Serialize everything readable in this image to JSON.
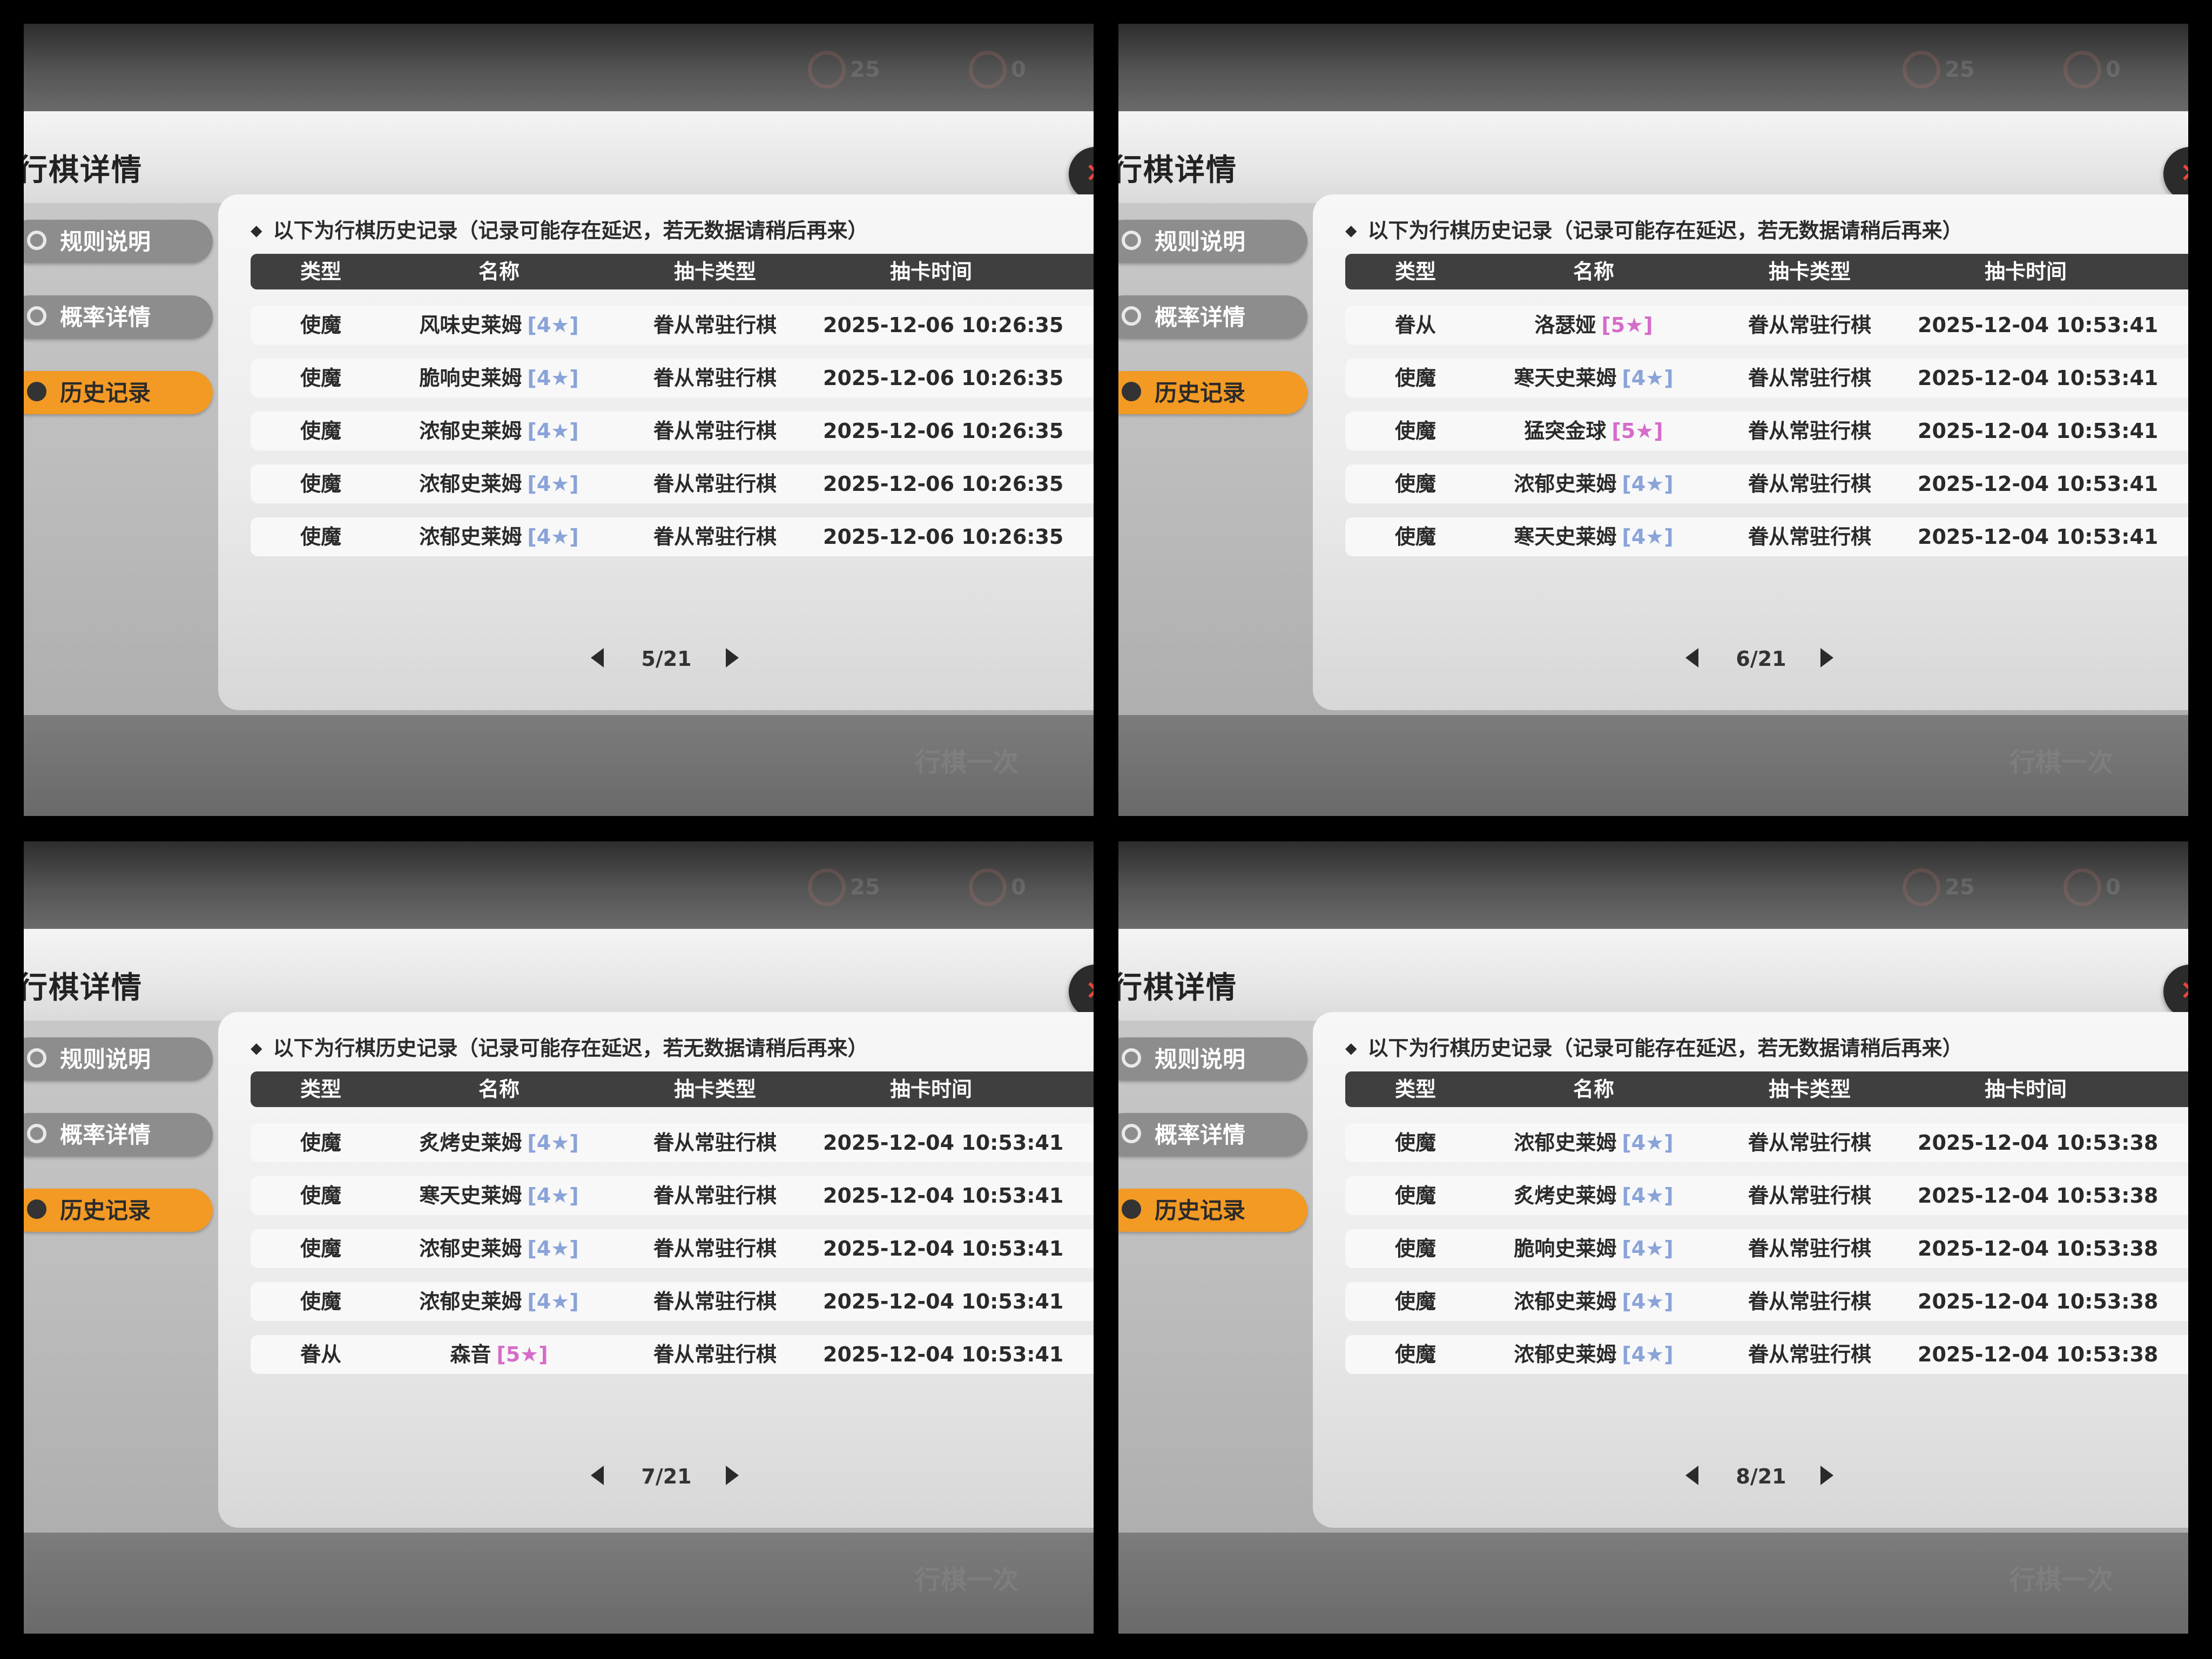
{
  "panels": [
    {
      "title": "行棋详情",
      "close_icon": "×",
      "hud": {
        "a": "25",
        "b": "0"
      },
      "tabs": [
        "规则说明",
        "概率详情",
        "历史记录"
      ],
      "notice": "以下为行棋历史记录（记录可能存在延迟，若无数据请稍后再来）",
      "headers": [
        "类型",
        "名称",
        "抽卡类型",
        "抽卡时间"
      ],
      "rows": [
        {
          "type": "使魔",
          "name": "风味史莱姆",
          "rarity": "[4★]",
          "rarity_level": 4,
          "pool": "眷从常驻行棋",
          "time": "2025-12-06 10:26:35"
        },
        {
          "type": "使魔",
          "name": "脆响史莱姆",
          "rarity": "[4★]",
          "rarity_level": 4,
          "pool": "眷从常驻行棋",
          "time": "2025-12-06 10:26:35"
        },
        {
          "type": "使魔",
          "name": "浓郁史莱姆",
          "rarity": "[4★]",
          "rarity_level": 4,
          "pool": "眷从常驻行棋",
          "time": "2025-12-06 10:26:35"
        },
        {
          "type": "使魔",
          "name": "浓郁史莱姆",
          "rarity": "[4★]",
          "rarity_level": 4,
          "pool": "眷从常驻行棋",
          "time": "2025-12-06 10:26:35"
        },
        {
          "type": "使魔",
          "name": "浓郁史莱姆",
          "rarity": "[4★]",
          "rarity_level": 4,
          "pool": "眷从常驻行棋",
          "time": "2025-12-06 10:26:35"
        }
      ],
      "page": "5/21",
      "bottom_hint": "行棋一次"
    },
    {
      "title": "行棋详情",
      "close_icon": "×",
      "hud": {
        "a": "25",
        "b": "0"
      },
      "tabs": [
        "规则说明",
        "概率详情",
        "历史记录"
      ],
      "notice": "以下为行棋历史记录（记录可能存在延迟，若无数据请稍后再来）",
      "headers": [
        "类型",
        "名称",
        "抽卡类型",
        "抽卡时间"
      ],
      "rows": [
        {
          "type": "眷从",
          "name": "洛瑟娅",
          "rarity": "[5★]",
          "rarity_level": 5,
          "pool": "眷从常驻行棋",
          "time": "2025-12-04 10:53:41"
        },
        {
          "type": "使魔",
          "name": "寒天史莱姆",
          "rarity": "[4★]",
          "rarity_level": 4,
          "pool": "眷从常驻行棋",
          "time": "2025-12-04 10:53:41"
        },
        {
          "type": "使魔",
          "name": "猛突金球",
          "rarity": "[5★]",
          "rarity_level": 5,
          "pool": "眷从常驻行棋",
          "time": "2025-12-04 10:53:41"
        },
        {
          "type": "使魔",
          "name": "浓郁史莱姆",
          "rarity": "[4★]",
          "rarity_level": 4,
          "pool": "眷从常驻行棋",
          "time": "2025-12-04 10:53:41"
        },
        {
          "type": "使魔",
          "name": "寒天史莱姆",
          "rarity": "[4★]",
          "rarity_level": 4,
          "pool": "眷从常驻行棋",
          "time": "2025-12-04 10:53:41"
        }
      ],
      "page": "6/21",
      "bottom_hint": "行棋一次"
    },
    {
      "title": "行棋详情",
      "close_icon": "×",
      "hud": {
        "a": "25",
        "b": "0"
      },
      "tabs": [
        "规则说明",
        "概率详情",
        "历史记录"
      ],
      "notice": "以下为行棋历史记录（记录可能存在延迟，若无数据请稍后再来）",
      "headers": [
        "类型",
        "名称",
        "抽卡类型",
        "抽卡时间"
      ],
      "rows": [
        {
          "type": "使魔",
          "name": "炙烤史莱姆",
          "rarity": "[4★]",
          "rarity_level": 4,
          "pool": "眷从常驻行棋",
          "time": "2025-12-04 10:53:41"
        },
        {
          "type": "使魔",
          "name": "寒天史莱姆",
          "rarity": "[4★]",
          "rarity_level": 4,
          "pool": "眷从常驻行棋",
          "time": "2025-12-04 10:53:41"
        },
        {
          "type": "使魔",
          "name": "浓郁史莱姆",
          "rarity": "[4★]",
          "rarity_level": 4,
          "pool": "眷从常驻行棋",
          "time": "2025-12-04 10:53:41"
        },
        {
          "type": "使魔",
          "name": "浓郁史莱姆",
          "rarity": "[4★]",
          "rarity_level": 4,
          "pool": "眷从常驻行棋",
          "time": "2025-12-04 10:53:41"
        },
        {
          "type": "眷从",
          "name": "森音",
          "rarity": "[5★]",
          "rarity_level": 5,
          "pool": "眷从常驻行棋",
          "time": "2025-12-04 10:53:41"
        }
      ],
      "page": "7/21",
      "bottom_hint": "行棋一次"
    },
    {
      "title": "行棋详情",
      "close_icon": "×",
      "hud": {
        "a": "25",
        "b": "0"
      },
      "tabs": [
        "规则说明",
        "概率详情",
        "历史记录"
      ],
      "notice": "以下为行棋历史记录（记录可能存在延迟，若无数据请稍后再来）",
      "headers": [
        "类型",
        "名称",
        "抽卡类型",
        "抽卡时间"
      ],
      "rows": [
        {
          "type": "使魔",
          "name": "浓郁史莱姆",
          "rarity": "[4★]",
          "rarity_level": 4,
          "pool": "眷从常驻行棋",
          "time": "2025-12-04 10:53:38"
        },
        {
          "type": "使魔",
          "name": "炙烤史莱姆",
          "rarity": "[4★]",
          "rarity_level": 4,
          "pool": "眷从常驻行棋",
          "time": "2025-12-04 10:53:38"
        },
        {
          "type": "使魔",
          "name": "脆响史莱姆",
          "rarity": "[4★]",
          "rarity_level": 4,
          "pool": "眷从常驻行棋",
          "time": "2025-12-04 10:53:38"
        },
        {
          "type": "使魔",
          "name": "浓郁史莱姆",
          "rarity": "[4★]",
          "rarity_level": 4,
          "pool": "眷从常驻行棋",
          "time": "2025-12-04 10:53:38"
        },
        {
          "type": "使魔",
          "name": "浓郁史莱姆",
          "rarity": "[4★]",
          "rarity_level": 4,
          "pool": "眷从常驻行棋",
          "time": "2025-12-04 10:53:38"
        }
      ],
      "page": "8/21",
      "bottom_hint": "行棋一次"
    }
  ]
}
